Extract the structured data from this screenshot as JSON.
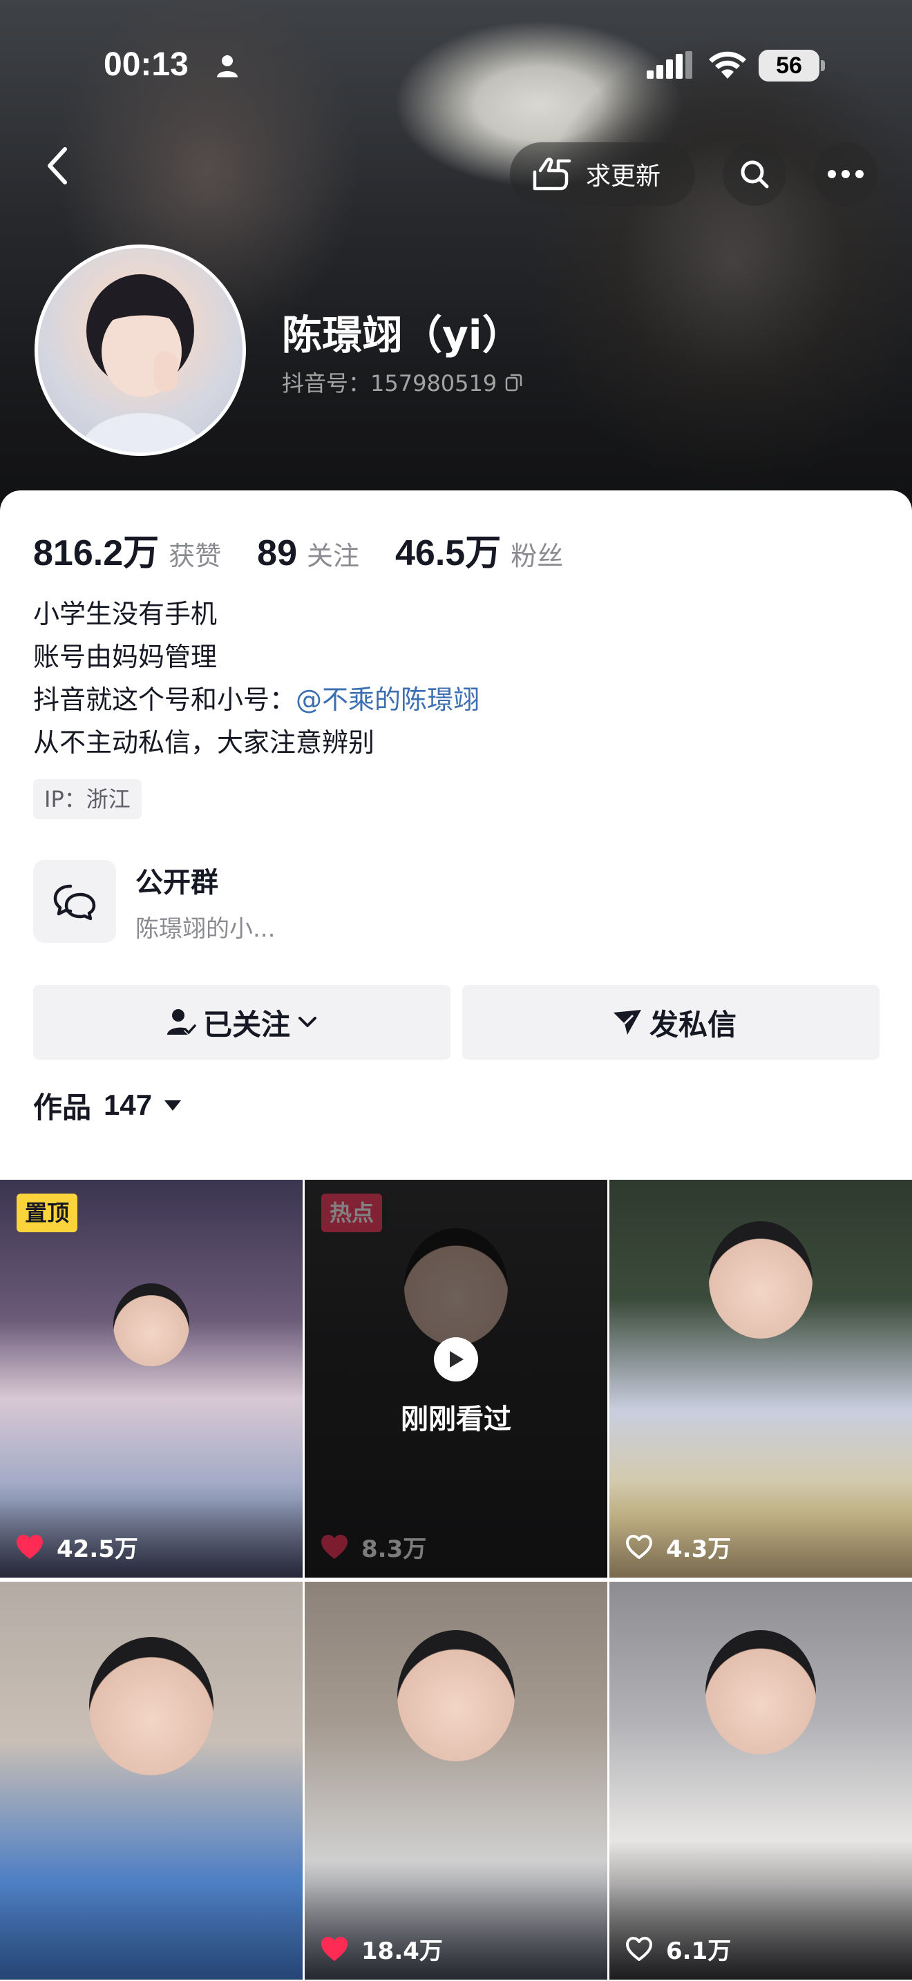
{
  "status_bar": {
    "time": "00:13",
    "battery": "56"
  },
  "header": {
    "request_update_label": "求更新",
    "back_icon": "chevron-left-icon",
    "search_icon": "search-icon",
    "more_icon": "more-dots-icon"
  },
  "profile": {
    "name": "陈璟翊（yi）",
    "douyin_id": "抖音号：157980519",
    "stats": [
      {
        "value": "816.2万",
        "label": "获赞"
      },
      {
        "value": "89",
        "label": "关注"
      },
      {
        "value": "46.5万",
        "label": "粉丝"
      }
    ],
    "bio": {
      "line1": "小学生没有手机",
      "line2": "账号由妈妈管理",
      "line3_prefix": "抖音就这个号和小号：",
      "line3_mention": "@不乘的陈璟翊",
      "line4": "从不主动私信，大家注意辨别"
    },
    "ip": "IP：浙江"
  },
  "group": {
    "title": "公开群",
    "subtitle": "陈璟翊的小..."
  },
  "actions": {
    "follow_label": "已关注",
    "message_label": "发私信"
  },
  "works": {
    "label": "作品",
    "count": "147"
  },
  "videos": [
    {
      "likes": "42.5万",
      "badge": "置顶",
      "liked": true
    },
    {
      "likes": "8.3万",
      "badge": "热点",
      "liked": true,
      "overlay": "刚刚看过"
    },
    {
      "likes": "4.3万",
      "liked": false
    },
    {
      "likes": "",
      "liked": false
    },
    {
      "likes": "18.4万",
      "liked": true
    },
    {
      "likes": "6.1万",
      "liked": false
    }
  ],
  "colors": {
    "accent_red": "#fe2c55",
    "pinned_yellow": "#fbd43b",
    "mention_blue": "#3c6fb1"
  }
}
